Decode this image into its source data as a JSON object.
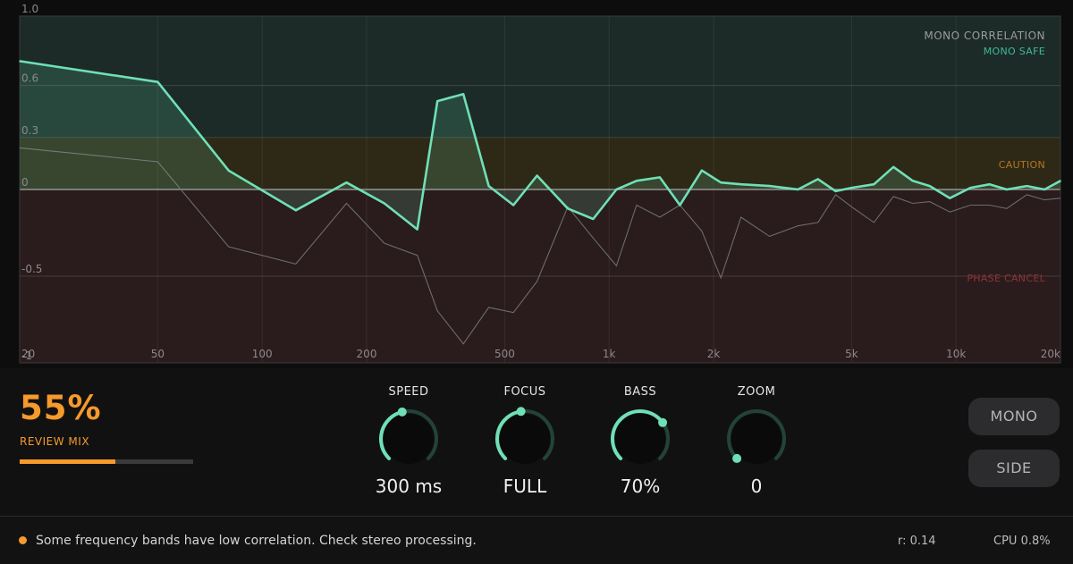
{
  "chart_data": {
    "type": "line",
    "title": "MONO CORRELATION",
    "x_scale": "log",
    "xlim": [
      20,
      20000
    ],
    "ylim": [
      -1,
      1
    ],
    "x_ticks": [
      {
        "v": 20,
        "label": "20"
      },
      {
        "v": 50,
        "label": "50"
      },
      {
        "v": 100,
        "label": "100"
      },
      {
        "v": 200,
        "label": "200"
      },
      {
        "v": 500,
        "label": "500"
      },
      {
        "v": 1000,
        "label": "1k"
      },
      {
        "v": 2000,
        "label": "2k"
      },
      {
        "v": 5000,
        "label": "5k"
      },
      {
        "v": 10000,
        "label": "10k"
      },
      {
        "v": 20000,
        "label": "20k"
      }
    ],
    "y_ticks": [
      {
        "v": 1,
        "label": "1.0"
      },
      {
        "v": 0.6,
        "label": "0.6"
      },
      {
        "v": 0.3,
        "label": "0.3"
      },
      {
        "v": 0,
        "label": "0"
      },
      {
        "v": -0.5,
        "label": "-0.5"
      },
      {
        "v": -1,
        "label": "-1"
      }
    ],
    "zones": [
      {
        "label": "MONO SAFE",
        "from": 0.3,
        "to": 1.0,
        "color": "#1c2b27",
        "text_color": "#3fb89a"
      },
      {
        "label": "CAUTION",
        "from": 0.0,
        "to": 0.3,
        "color": "#2e2816",
        "text_color": "#b5761f"
      },
      {
        "label": "PHASE CANCEL",
        "from": -1.0,
        "to": 0.0,
        "color": "#2a1b1d",
        "text_color": "#8e3434"
      }
    ],
    "series": [
      {
        "role": "current",
        "color": "#6fe0b6",
        "x": [
          20,
          50,
          80,
          125,
          175,
          225,
          280,
          320,
          380,
          450,
          530,
          620,
          760,
          900,
          1050,
          1200,
          1400,
          1600,
          1850,
          2100,
          2400,
          2900,
          3500,
          4000,
          4500,
          5000,
          5800,
          6600,
          7500,
          8400,
          9600,
          11000,
          12500,
          14000,
          16000,
          18000,
          20000
        ],
        "y": [
          0.74,
          0.62,
          0.11,
          -0.12,
          0.04,
          -0.08,
          -0.23,
          0.51,
          0.55,
          0.02,
          -0.09,
          0.08,
          -0.11,
          -0.17,
          0.0,
          0.05,
          0.07,
          -0.09,
          0.11,
          0.04,
          0.03,
          0.02,
          0.0,
          0.06,
          -0.01,
          0.01,
          0.03,
          0.13,
          0.05,
          0.02,
          -0.05,
          0.01,
          0.03,
          0.0,
          0.02,
          0.0,
          0.05
        ]
      },
      {
        "role": "reference",
        "color": "#6a6e6c",
        "x": [
          20,
          50,
          80,
          125,
          175,
          225,
          280,
          320,
          380,
          450,
          530,
          620,
          760,
          900,
          1050,
          1200,
          1400,
          1600,
          1850,
          2100,
          2400,
          2900,
          3500,
          4000,
          4500,
          5000,
          5800,
          6600,
          7500,
          8400,
          9600,
          11000,
          12500,
          14000,
          16000,
          18000,
          20000
        ],
        "y": [
          0.24,
          0.16,
          -0.33,
          -0.43,
          -0.08,
          -0.31,
          -0.38,
          -0.7,
          -0.89,
          -0.68,
          -0.71,
          -0.53,
          -0.1,
          -0.28,
          -0.44,
          -0.09,
          -0.16,
          -0.09,
          -0.24,
          -0.51,
          -0.16,
          -0.27,
          -0.21,
          -0.19,
          -0.03,
          -0.1,
          -0.19,
          -0.04,
          -0.08,
          -0.07,
          -0.13,
          -0.09,
          -0.09,
          -0.11,
          -0.03,
          -0.06,
          -0.05
        ]
      }
    ]
  },
  "review_mix": {
    "value": "55%",
    "label": "REVIEW MIX",
    "level": 0.55
  },
  "knobs": [
    {
      "name": "speed",
      "label": "SPEED",
      "value": "300 ms",
      "level": 0.45
    },
    {
      "name": "focus",
      "label": "FOCUS",
      "value": "FULL",
      "level": 0.47
    },
    {
      "name": "bass",
      "label": "BASS",
      "value": "70%",
      "level": 0.7
    },
    {
      "name": "zoom",
      "label": "ZOOM",
      "value": "0",
      "level": 0.0
    }
  ],
  "buttons": {
    "mono": "MONO",
    "side": "SIDE"
  },
  "status": {
    "message": "Some frequency bands have low correlation. Check stereo processing.",
    "correlation": "r: 0.14",
    "cpu": "CPU  0.8%"
  },
  "colors": {
    "accent": "#f59a2b",
    "teal": "#6fe0b6",
    "knob_track": "#23433a"
  },
  "icons": {
    "status": "warning-dot-icon"
  }
}
